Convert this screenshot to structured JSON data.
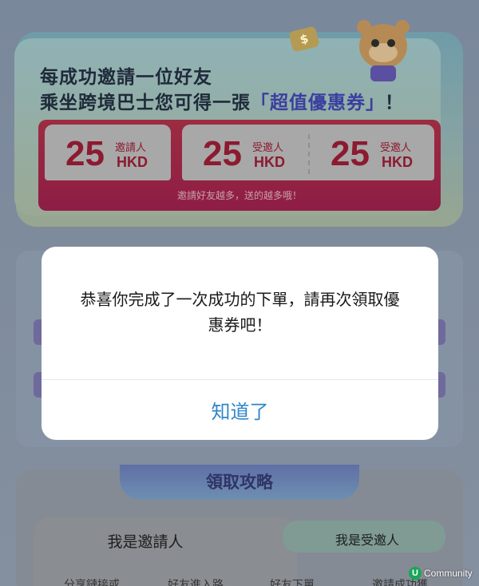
{
  "promo": {
    "line1": "每成功邀請一位好友",
    "line2_prefix": "乘坐跨境巴士您可得一張",
    "line2_highlight": "「超值優惠券」",
    "line2_suffix": "！",
    "coin_symbol": "$",
    "rewards": [
      {
        "amount": "25",
        "label": "邀請人",
        "unit": "HKD"
      },
      {
        "amount": "25",
        "label": "受邀人",
        "unit": "HKD"
      },
      {
        "amount": "25",
        "label": "受邀人",
        "unit": "HKD"
      }
    ],
    "note": "邀請好友越多，送的越多哦！"
  },
  "strategy": {
    "title": "領取攻略",
    "tab_inviter": "我是邀請人",
    "tab_invitee": "我是受邀人",
    "steps": [
      "分享鏈接或",
      "好友進入路",
      "好友下單",
      "邀請成功獲"
    ]
  },
  "modal": {
    "message": "恭喜你完成了一次成功的下單，請再次領取優惠券吧！",
    "button_label": "知道了"
  },
  "watermark": {
    "badge": "U",
    "text": "Community"
  },
  "colors": {
    "accent_blue": "#2f86c9",
    "promo_red": "#8c1a30",
    "overlay": "#7f8ca0"
  }
}
